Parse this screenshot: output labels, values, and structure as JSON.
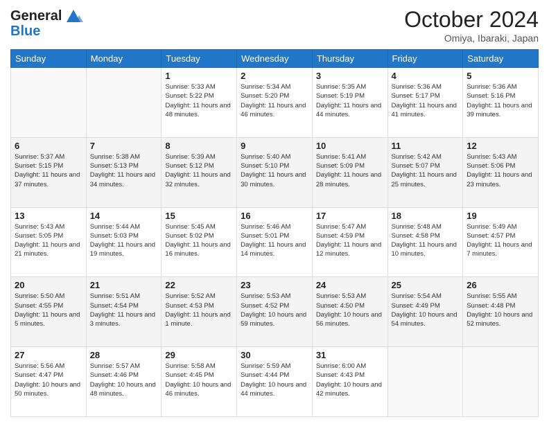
{
  "header": {
    "logo_line1": "General",
    "logo_line2": "Blue",
    "month_title": "October 2024",
    "location": "Omiya, Ibaraki, Japan"
  },
  "days_of_week": [
    "Sunday",
    "Monday",
    "Tuesday",
    "Wednesday",
    "Thursday",
    "Friday",
    "Saturday"
  ],
  "weeks": [
    [
      {
        "day": "",
        "sunrise": "",
        "sunset": "",
        "daylight": ""
      },
      {
        "day": "",
        "sunrise": "",
        "sunset": "",
        "daylight": ""
      },
      {
        "day": "1",
        "sunrise": "Sunrise: 5:33 AM",
        "sunset": "Sunset: 5:22 PM",
        "daylight": "Daylight: 11 hours and 48 minutes."
      },
      {
        "day": "2",
        "sunrise": "Sunrise: 5:34 AM",
        "sunset": "Sunset: 5:20 PM",
        "daylight": "Daylight: 11 hours and 46 minutes."
      },
      {
        "day": "3",
        "sunrise": "Sunrise: 5:35 AM",
        "sunset": "Sunset: 5:19 PM",
        "daylight": "Daylight: 11 hours and 44 minutes."
      },
      {
        "day": "4",
        "sunrise": "Sunrise: 5:36 AM",
        "sunset": "Sunset: 5:17 PM",
        "daylight": "Daylight: 11 hours and 41 minutes."
      },
      {
        "day": "5",
        "sunrise": "Sunrise: 5:36 AM",
        "sunset": "Sunset: 5:16 PM",
        "daylight": "Daylight: 11 hours and 39 minutes."
      }
    ],
    [
      {
        "day": "6",
        "sunrise": "Sunrise: 5:37 AM",
        "sunset": "Sunset: 5:15 PM",
        "daylight": "Daylight: 11 hours and 37 minutes."
      },
      {
        "day": "7",
        "sunrise": "Sunrise: 5:38 AM",
        "sunset": "Sunset: 5:13 PM",
        "daylight": "Daylight: 11 hours and 34 minutes."
      },
      {
        "day": "8",
        "sunrise": "Sunrise: 5:39 AM",
        "sunset": "Sunset: 5:12 PM",
        "daylight": "Daylight: 11 hours and 32 minutes."
      },
      {
        "day": "9",
        "sunrise": "Sunrise: 5:40 AM",
        "sunset": "Sunset: 5:10 PM",
        "daylight": "Daylight: 11 hours and 30 minutes."
      },
      {
        "day": "10",
        "sunrise": "Sunrise: 5:41 AM",
        "sunset": "Sunset: 5:09 PM",
        "daylight": "Daylight: 11 hours and 28 minutes."
      },
      {
        "day": "11",
        "sunrise": "Sunrise: 5:42 AM",
        "sunset": "Sunset: 5:07 PM",
        "daylight": "Daylight: 11 hours and 25 minutes."
      },
      {
        "day": "12",
        "sunrise": "Sunrise: 5:43 AM",
        "sunset": "Sunset: 5:06 PM",
        "daylight": "Daylight: 11 hours and 23 minutes."
      }
    ],
    [
      {
        "day": "13",
        "sunrise": "Sunrise: 5:43 AM",
        "sunset": "Sunset: 5:05 PM",
        "daylight": "Daylight: 11 hours and 21 minutes."
      },
      {
        "day": "14",
        "sunrise": "Sunrise: 5:44 AM",
        "sunset": "Sunset: 5:03 PM",
        "daylight": "Daylight: 11 hours and 19 minutes."
      },
      {
        "day": "15",
        "sunrise": "Sunrise: 5:45 AM",
        "sunset": "Sunset: 5:02 PM",
        "daylight": "Daylight: 11 hours and 16 minutes."
      },
      {
        "day": "16",
        "sunrise": "Sunrise: 5:46 AM",
        "sunset": "Sunset: 5:01 PM",
        "daylight": "Daylight: 11 hours and 14 minutes."
      },
      {
        "day": "17",
        "sunrise": "Sunrise: 5:47 AM",
        "sunset": "Sunset: 4:59 PM",
        "daylight": "Daylight: 11 hours and 12 minutes."
      },
      {
        "day": "18",
        "sunrise": "Sunrise: 5:48 AM",
        "sunset": "Sunset: 4:58 PM",
        "daylight": "Daylight: 11 hours and 10 minutes."
      },
      {
        "day": "19",
        "sunrise": "Sunrise: 5:49 AM",
        "sunset": "Sunset: 4:57 PM",
        "daylight": "Daylight: 11 hours and 7 minutes."
      }
    ],
    [
      {
        "day": "20",
        "sunrise": "Sunrise: 5:50 AM",
        "sunset": "Sunset: 4:55 PM",
        "daylight": "Daylight: 11 hours and 5 minutes."
      },
      {
        "day": "21",
        "sunrise": "Sunrise: 5:51 AM",
        "sunset": "Sunset: 4:54 PM",
        "daylight": "Daylight: 11 hours and 3 minutes."
      },
      {
        "day": "22",
        "sunrise": "Sunrise: 5:52 AM",
        "sunset": "Sunset: 4:53 PM",
        "daylight": "Daylight: 11 hours and 1 minute."
      },
      {
        "day": "23",
        "sunrise": "Sunrise: 5:53 AM",
        "sunset": "Sunset: 4:52 PM",
        "daylight": "Daylight: 10 hours and 59 minutes."
      },
      {
        "day": "24",
        "sunrise": "Sunrise: 5:53 AM",
        "sunset": "Sunset: 4:50 PM",
        "daylight": "Daylight: 10 hours and 56 minutes."
      },
      {
        "day": "25",
        "sunrise": "Sunrise: 5:54 AM",
        "sunset": "Sunset: 4:49 PM",
        "daylight": "Daylight: 10 hours and 54 minutes."
      },
      {
        "day": "26",
        "sunrise": "Sunrise: 5:55 AM",
        "sunset": "Sunset: 4:48 PM",
        "daylight": "Daylight: 10 hours and 52 minutes."
      }
    ],
    [
      {
        "day": "27",
        "sunrise": "Sunrise: 5:56 AM",
        "sunset": "Sunset: 4:47 PM",
        "daylight": "Daylight: 10 hours and 50 minutes."
      },
      {
        "day": "28",
        "sunrise": "Sunrise: 5:57 AM",
        "sunset": "Sunset: 4:46 PM",
        "daylight": "Daylight: 10 hours and 48 minutes."
      },
      {
        "day": "29",
        "sunrise": "Sunrise: 5:58 AM",
        "sunset": "Sunset: 4:45 PM",
        "daylight": "Daylight: 10 hours and 46 minutes."
      },
      {
        "day": "30",
        "sunrise": "Sunrise: 5:59 AM",
        "sunset": "Sunset: 4:44 PM",
        "daylight": "Daylight: 10 hours and 44 minutes."
      },
      {
        "day": "31",
        "sunrise": "Sunrise: 6:00 AM",
        "sunset": "Sunset: 4:43 PM",
        "daylight": "Daylight: 10 hours and 42 minutes."
      },
      {
        "day": "",
        "sunrise": "",
        "sunset": "",
        "daylight": ""
      },
      {
        "day": "",
        "sunrise": "",
        "sunset": "",
        "daylight": ""
      }
    ]
  ]
}
